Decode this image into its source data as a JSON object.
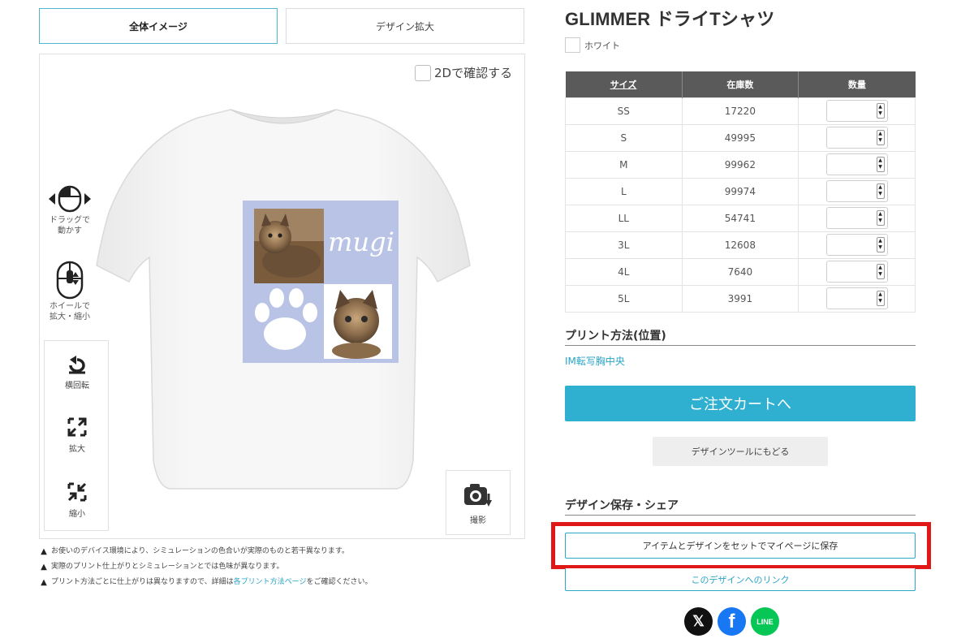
{
  "tabs": [
    {
      "label": "全体イメージ",
      "active": true
    },
    {
      "label": "デザイン拡大",
      "active": false
    }
  ],
  "viewer": {
    "check_2d_label": "2Dで確認する",
    "drag_hint": "ドラッグで\n動かす",
    "wheel_hint": "ホイールで\n拡大・縮小",
    "controls": {
      "rotate": "横回転",
      "zoom_in": "拡大",
      "zoom_out": "縮小"
    },
    "photo_label": "撮影",
    "design_text": "mugi",
    "design_colors": {
      "panel": "#b9c3e6",
      "shirt": "#f4f4f4"
    },
    "icons": [
      "mouse-drag-icon",
      "mouse-wheel-icon",
      "rotate-icon",
      "expand-icon",
      "shrink-icon",
      "camera-icon"
    ]
  },
  "notes": {
    "line1": "お使いのデバイス環境により、シミュレーションの色合いが実際のものと若干異なります。",
    "line2": "実際のプリント仕上がりとシミュレーションとでは色味が異なります。",
    "line3_pre": "プリント方法ごとに仕上がりは異なりますので、詳細は",
    "line3_link": "各プリント方法ページ",
    "line3_post": "をご確認ください。"
  },
  "product": {
    "title": "GLIMMER ドライTシャツ",
    "color_label": "ホワイト",
    "table": {
      "headers": [
        "サイズ",
        "在庫数",
        "数量"
      ],
      "rows": [
        {
          "size": "SS",
          "stock": "17220"
        },
        {
          "size": "S",
          "stock": "49995"
        },
        {
          "size": "M",
          "stock": "99962"
        },
        {
          "size": "L",
          "stock": "99974"
        },
        {
          "size": "LL",
          "stock": "54741"
        },
        {
          "size": "3L",
          "stock": "12608"
        },
        {
          "size": "4L",
          "stock": "7640"
        },
        {
          "size": "5L",
          "stock": "3991"
        }
      ]
    },
    "print_heading": "プリント方法(位置)",
    "print_method": "IM転写胸中央",
    "cart_button": "ご注文カートへ",
    "back_button": "デザインツールにもどる",
    "save_heading": "デザイン保存・シェア",
    "save_button": "アイテムとデザインをセットでマイページに保存",
    "link_button": "このデザインへのリンク",
    "social": {
      "x": "𝕏",
      "facebook": "f",
      "line": "LINE"
    }
  },
  "colors": {
    "accent": "#2fb0d0",
    "highlight": "#e01818",
    "table_header": "#5a5a5a"
  }
}
